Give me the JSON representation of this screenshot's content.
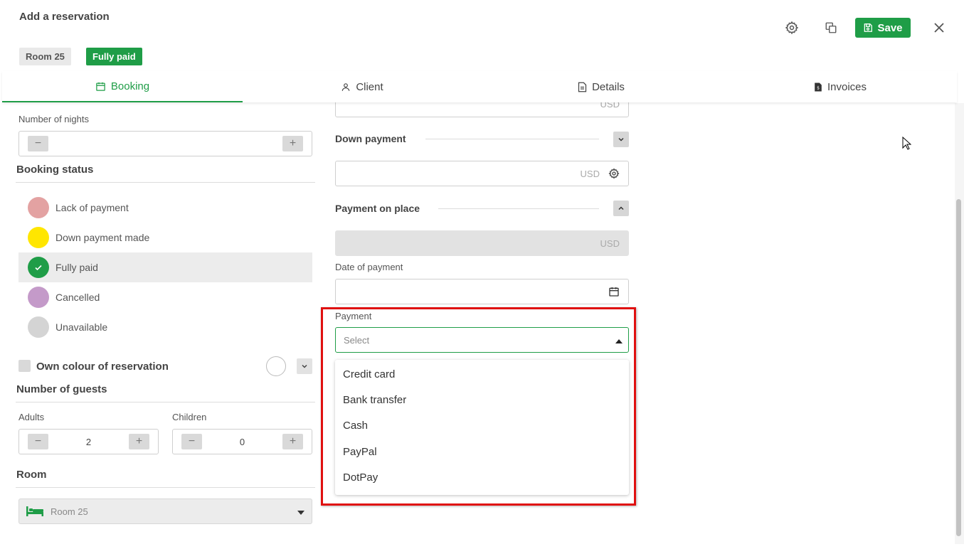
{
  "header": {
    "title": "Add a reservation",
    "save_label": "Save",
    "room_badge": "Room 25",
    "status_badge": "Fully paid"
  },
  "tabs": [
    {
      "label": "Booking",
      "icon": "calendar-icon",
      "active": true
    },
    {
      "label": "Client",
      "icon": "user-icon"
    },
    {
      "label": "Details",
      "icon": "document-icon"
    },
    {
      "label": "Invoices",
      "icon": "invoice-icon"
    }
  ],
  "booking": {
    "nights_label": "Number of nights",
    "nights_value": "",
    "status_title": "Booking status",
    "statuses": [
      {
        "label": "Lack of payment",
        "color": "#e3a2a2"
      },
      {
        "label": "Down payment made",
        "color": "#ffe600"
      },
      {
        "label": "Fully paid",
        "color": "#1f9d47",
        "selected": true
      },
      {
        "label": "Cancelled",
        "color": "#c49ac9"
      },
      {
        "label": "Unavailable",
        "color": "#d4d4d4"
      }
    ],
    "own_colour_label": "Own colour of reservation",
    "guests_title": "Number of guests",
    "adults_label": "Adults",
    "adults_value": "2",
    "children_label": "Children",
    "children_value": "0",
    "room_title": "Room",
    "room_value": "Room 25"
  },
  "payment": {
    "currency": "USD",
    "down_payment_label": "Down payment",
    "on_place_label": "Payment on place",
    "date_label": "Date of payment",
    "payment_label": "Payment",
    "select_placeholder": "Select",
    "options": [
      "Credit card",
      "Bank transfer",
      "Cash",
      "PayPal",
      "DotPay"
    ]
  },
  "colors": {
    "accent": "#1f9d47",
    "highlight": "#e01010"
  }
}
